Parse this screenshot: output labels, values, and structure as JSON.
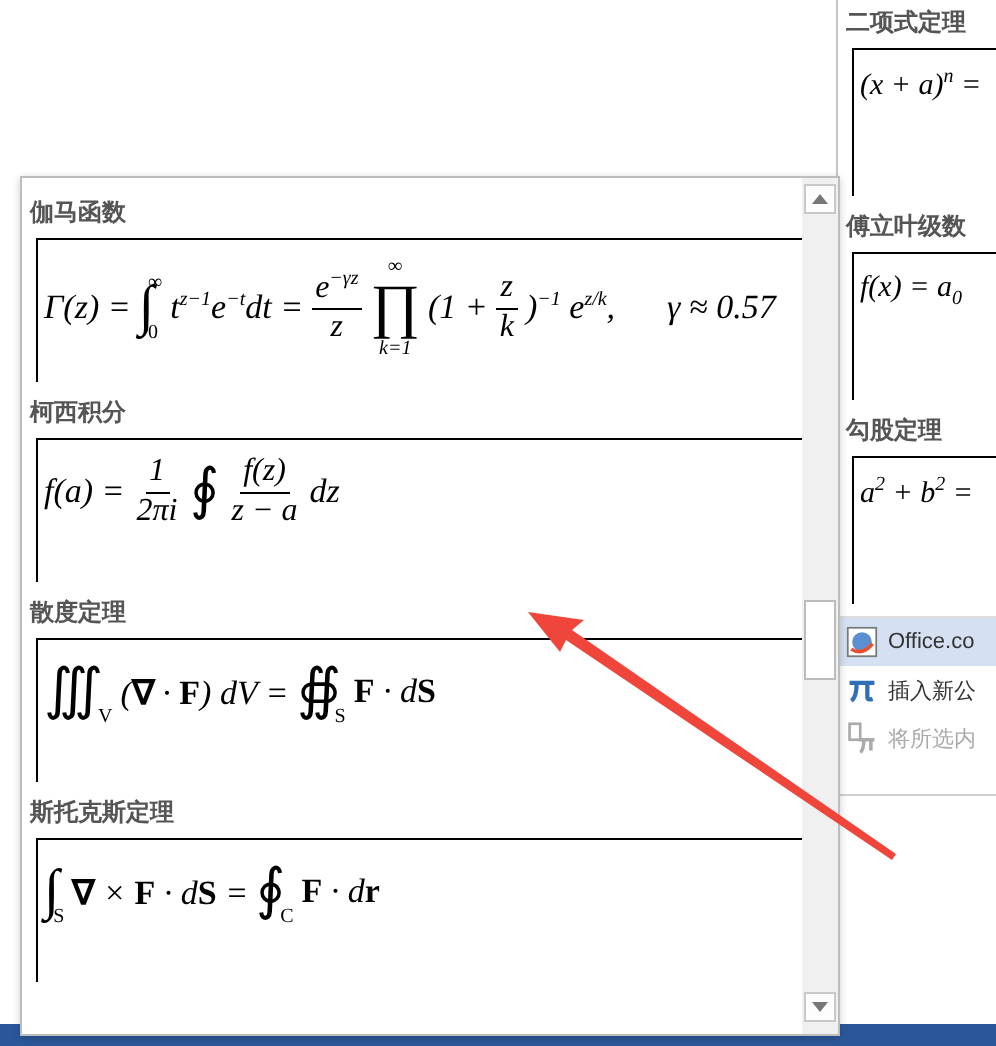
{
  "back_gallery": {
    "sections": [
      {
        "title": "二项式定理",
        "formula": [
          {
            "kind": "text",
            "text": "(x + a)$^{n}$ ="
          }
        ]
      },
      {
        "title": "傅立叶级数",
        "formula": [
          {
            "kind": "text",
            "text": "f(x) = a$_{0}$"
          }
        ]
      },
      {
        "title": "勾股定理",
        "formula": [
          {
            "kind": "text",
            "text": "a$^{2}$ + b$^{2}$ ="
          }
        ]
      }
    ],
    "menu": [
      {
        "kind": "globe",
        "label": "Office.co",
        "selected": true,
        "disabled": false
      },
      {
        "kind": "pi",
        "label": "插入新公",
        "selected": false,
        "disabled": false
      },
      {
        "kind": "pi-selection",
        "label": "将所选内",
        "selected": false,
        "disabled": true
      }
    ]
  },
  "front_gallery": {
    "sections": [
      {
        "title": "伽马函数",
        "formula": [
          {
            "kind": "text",
            "text": "Γ(z) ="
          },
          {
            "kind": "op",
            "symbol": "∫",
            "sub": "0",
            "sup": "∞"
          },
          {
            "kind": "text",
            "text": "t$^{z−1}$e$^{−t}$dt ="
          },
          {
            "kind": "frac",
            "num": "e$^{−γz}$",
            "den": "z"
          },
          {
            "kind": "bigop",
            "symbol": "∏",
            "sub": "k=1",
            "sup": "∞"
          },
          {
            "kind": "text",
            "text": "(1 +"
          },
          {
            "kind": "frac",
            "num": "z",
            "den": "k"
          },
          {
            "kind": "text",
            "text": ")$^{−1}$ e$^{z/k}$,"
          },
          {
            "kind": "text",
            "text": "γ ≈ 0.57"
          }
        ]
      },
      {
        "title": "柯西积分",
        "formula": [
          {
            "kind": "text",
            "text": "f(a) ="
          },
          {
            "kind": "frac",
            "num": "1",
            "den": "2πi"
          },
          {
            "kind": "op",
            "symbol": "∮"
          },
          {
            "kind": "frac",
            "num": "f(z)",
            "den": "z − a"
          },
          {
            "kind": "text",
            "text": "dz"
          }
        ]
      },
      {
        "title": "散度定理",
        "formula": [
          {
            "kind": "op",
            "symbol": "∭",
            "sub": "V"
          },
          {
            "kind": "text",
            "text": "(**∇** · **F**) dV ="
          },
          {
            "kind": "op",
            "symbol": "∯",
            "sub": "S"
          },
          {
            "kind": "text",
            "text": "**F** · d**S**"
          }
        ]
      },
      {
        "title": "斯托克斯定理",
        "formula": [
          {
            "kind": "op",
            "symbol": "∫",
            "sub": "S"
          },
          {
            "kind": "text",
            "text": "**∇** × **F** · d**S** ="
          },
          {
            "kind": "op",
            "symbol": "∮",
            "sub": "C"
          },
          {
            "kind": "text",
            "text": "**F** · d**r**"
          }
        ]
      }
    ]
  }
}
